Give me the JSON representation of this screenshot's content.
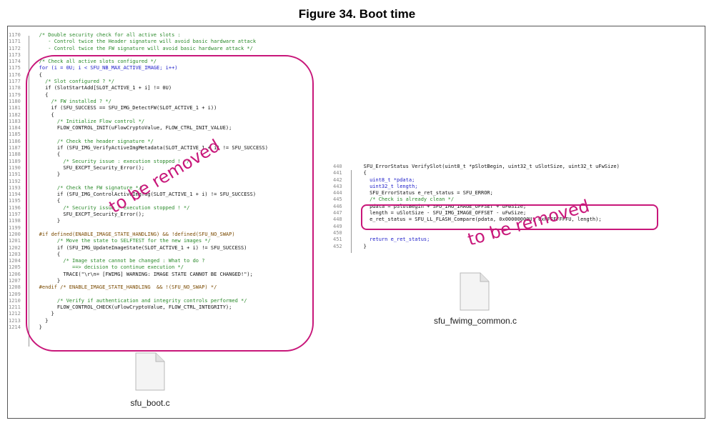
{
  "figure_title": "Figure 34. Boot time",
  "left_code": [
    {
      "n": "1170",
      "t": "/* Double security check for all active slots :",
      "c": "cm"
    },
    {
      "n": "1171",
      "t": "   - Control twice the Header signature will avoid basic hardware attack",
      "c": "cm"
    },
    {
      "n": "1172",
      "t": "   - Control twice the FW signature will avoid basic hardware attack */",
      "c": "cm"
    },
    {
      "n": "1173",
      "t": "",
      "c": ""
    },
    {
      "n": "1174",
      "t": "/* Check all active slots configured */",
      "c": "cm"
    },
    {
      "n": "1175",
      "t": "for (i = 0U; i < SFU_NB_MAX_ACTIVE_IMAGE; i++)",
      "c": "kw"
    },
    {
      "n": "1176",
      "t": "{",
      "c": ""
    },
    {
      "n": "1177",
      "t": "  /* Slot configured ? */",
      "c": "cm"
    },
    {
      "n": "1178",
      "t": "  if (SlotStartAdd[SLOT_ACTIVE_1 + i] != 0U)",
      "c": ""
    },
    {
      "n": "1179",
      "t": "  {",
      "c": ""
    },
    {
      "n": "1180",
      "t": "    /* FW installed ? */",
      "c": "cm"
    },
    {
      "n": "1181",
      "t": "    if (SFU_SUCCESS == SFU_IMG_DetectFW(SLOT_ACTIVE_1 + i))",
      "c": ""
    },
    {
      "n": "1182",
      "t": "    {",
      "c": ""
    },
    {
      "n": "1183",
      "t": "      /* Initialize Flow control */",
      "c": "cm"
    },
    {
      "n": "1184",
      "t": "      FLOW_CONTROL_INIT(uFlowCryptoValue, FLOW_CTRL_INIT_VALUE);",
      "c": ""
    },
    {
      "n": "1185",
      "t": "",
      "c": ""
    },
    {
      "n": "1186",
      "t": "      /* Check the header signature */",
      "c": "cm"
    },
    {
      "n": "1187",
      "t": "      if (SFU_IMG_VerifyActiveImgMetadata(SLOT_ACTIVE_1 + i) != SFU_SUCCESS)",
      "c": ""
    },
    {
      "n": "1188",
      "t": "      {",
      "c": ""
    },
    {
      "n": "1189",
      "t": "        /* Security issue : execution stopped ! */",
      "c": "cm"
    },
    {
      "n": "1190",
      "t": "        SFU_EXCPT_Security_Error();",
      "c": ""
    },
    {
      "n": "1191",
      "t": "      }",
      "c": ""
    },
    {
      "n": "1192",
      "t": "",
      "c": ""
    },
    {
      "n": "1193",
      "t": "      /* Check the FW signature */",
      "c": "cm"
    },
    {
      "n": "1194",
      "t": "      if (SFU_IMG_ControlActiveImgTag(SLOT_ACTIVE_1 + i) != SFU_SUCCESS)",
      "c": ""
    },
    {
      "n": "1195",
      "t": "      {",
      "c": ""
    },
    {
      "n": "1196",
      "t": "        /* Security issue : execution stopped ! */",
      "c": "cm"
    },
    {
      "n": "1197",
      "t": "        SFU_EXCPT_Security_Error();",
      "c": ""
    },
    {
      "n": "1198",
      "t": "      }",
      "c": ""
    },
    {
      "n": "1199",
      "t": "",
      "c": ""
    },
    {
      "n": "1200",
      "t": "#if defined(ENABLE_IMAGE_STATE_HANDLING) && !defined(SFU_NO_SWAP)",
      "c": "pp"
    },
    {
      "n": "1201",
      "t": "      /* Move the state to SELFTEST for the new images */",
      "c": "cm"
    },
    {
      "n": "1202",
      "t": "      if (SFU_IMG_UpdateImageState(SLOT_ACTIVE_1 + i) != SFU_SUCCESS)",
      "c": ""
    },
    {
      "n": "1203",
      "t": "      {",
      "c": ""
    },
    {
      "n": "1204",
      "t": "        /* Image state cannot be changed : What to do ?",
      "c": "cm"
    },
    {
      "n": "1205",
      "t": "           ==> decision to continue execution */",
      "c": "cm"
    },
    {
      "n": "1206",
      "t": "        TRACE(\"\\r\\n= [FWIMG] WARNING: IMAGE STATE CANNOT BE CHANGED!\");",
      "c": ""
    },
    {
      "n": "1207",
      "t": "      }",
      "c": ""
    },
    {
      "n": "1208",
      "t": "#endif /* ENABLE_IMAGE_STATE_HANDLING  && !(SFU_NO_SWAP) */",
      "c": "pp"
    },
    {
      "n": "1209",
      "t": "",
      "c": ""
    },
    {
      "n": "1210",
      "t": "      /* Verify if authentication and integrity controls performed */",
      "c": "cm"
    },
    {
      "n": "1211",
      "t": "      FLOW_CONTROL_CHECK(uFlowCryptoValue, FLOW_CTRL_INTEGRITY);",
      "c": ""
    },
    {
      "n": "1212",
      "t": "    }",
      "c": ""
    },
    {
      "n": "1213",
      "t": "  }",
      "c": ""
    },
    {
      "n": "1214",
      "t": "}",
      "c": ""
    }
  ],
  "right_code": [
    {
      "n": "440",
      "t": "SFU_ErrorStatus VerifySlot(uint8_t *pSlotBegin, uint32_t uSlotSize, uint32_t uFwSize)",
      "c": ""
    },
    {
      "n": "441",
      "t": "{",
      "c": ""
    },
    {
      "n": "442",
      "t": "  uint8_t *pdata;",
      "c": "kw"
    },
    {
      "n": "443",
      "t": "  uint32_t length;",
      "c": "kw"
    },
    {
      "n": "444",
      "t": "  SFU_ErrorStatus e_ret_status = SFU_ERROR;",
      "c": ""
    },
    {
      "n": "445",
      "t": "  /* Check is already clean */",
      "c": "cm"
    },
    {
      "n": "446",
      "t": "  pdata = pSlotBegin + SFU_IMG_IMAGE_OFFSET + uFwSize;",
      "c": ""
    },
    {
      "n": "447",
      "t": "  length = uSlotSize - SFU_IMG_IMAGE_OFFSET - uFwSize;",
      "c": ""
    },
    {
      "n": "448",
      "t": "  e_ret_status = SFU_LL_FLASH_Compare(pdata, 0x00000000U, 0xFFFFFFFFU, length);",
      "c": ""
    },
    {
      "n": "449",
      "t": "",
      "c": ""
    },
    {
      "n": "450",
      "t": "",
      "c": ""
    },
    {
      "n": "451",
      "t": "  return e_ret_status;",
      "c": "kw"
    },
    {
      "n": "452",
      "t": "}",
      "c": ""
    }
  ],
  "removed_label_left": "to be removed",
  "removed_label_right": "to be removed",
  "file_left": "sfu_boot.c",
  "file_right": "sfu_fwimg_common.c",
  "colors": {
    "highlight": "#c8177a",
    "comment": "#2a8a2a",
    "keyword": "#1a1ac8"
  }
}
